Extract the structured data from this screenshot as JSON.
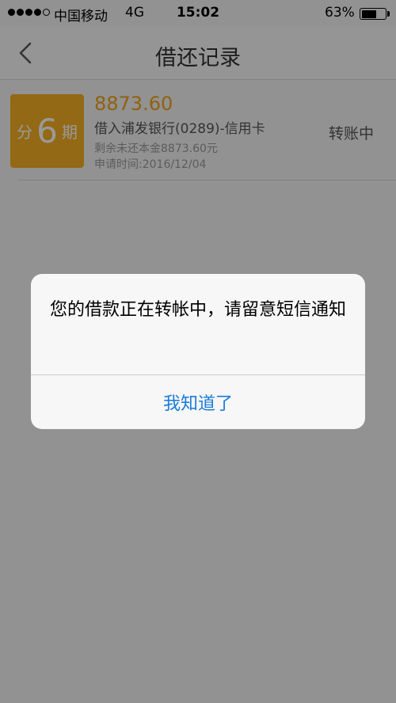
{
  "status_bar": {
    "carrier": "中国移动",
    "network": "4G",
    "time": "15:02",
    "battery_percent": "63%",
    "battery_level": 0.63
  },
  "nav": {
    "title": "借还记录",
    "back_icon": "chevron-left-icon"
  },
  "record": {
    "badge": {
      "prefix": "分",
      "number": "6",
      "suffix": "期",
      "color": "#f6b024"
    },
    "amount": "8873.60",
    "bank": "借入浦发银行(0289)-信用卡",
    "remaining": "剩余未还本金8873.60元",
    "apply_time": "申请时间:2016/12/04",
    "status": "转账中"
  },
  "alert": {
    "message": "您的借款正在转帐中，请留意短信通知",
    "button": "我知道了",
    "button_color": "#1a7bd8"
  }
}
